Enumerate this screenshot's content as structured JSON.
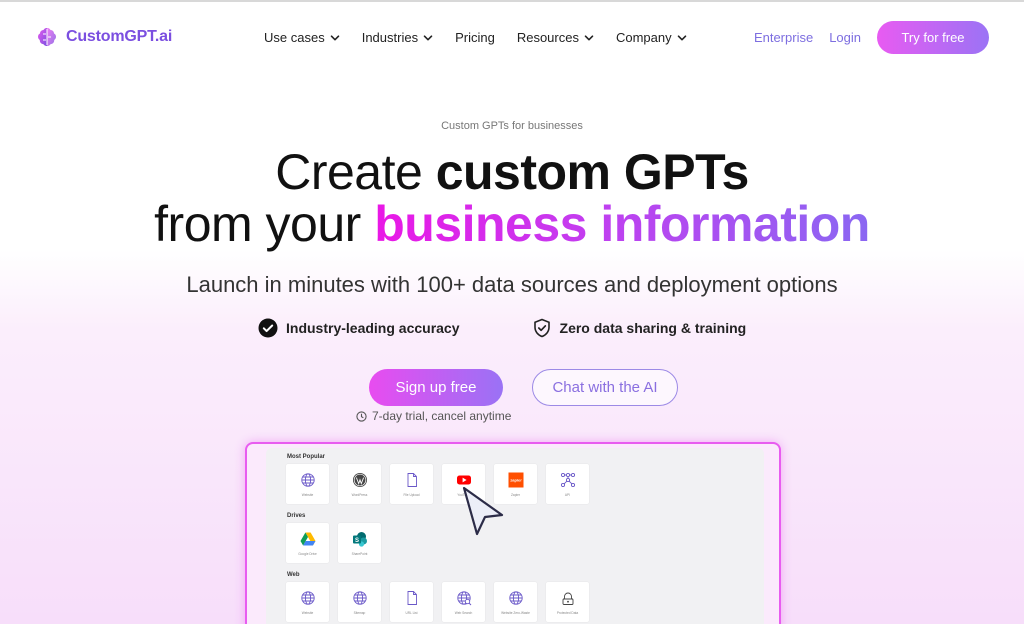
{
  "brand": {
    "name": "CustomGPT.ai"
  },
  "nav": {
    "menu": [
      {
        "label": "Use cases",
        "has_dropdown": true
      },
      {
        "label": "Industries",
        "has_dropdown": true
      },
      {
        "label": "Pricing",
        "has_dropdown": false
      },
      {
        "label": "Resources",
        "has_dropdown": true
      },
      {
        "label": "Company",
        "has_dropdown": true
      }
    ],
    "enterprise": "Enterprise",
    "login": "Login",
    "cta": "Try for free"
  },
  "hero": {
    "eyebrow": "Custom GPTs for businesses",
    "line1_plain": "Create ",
    "line1_bold": "custom GPTs",
    "line2_plain": "from your ",
    "line2_gradient": "business information",
    "subtitle": "Launch in minutes with 100+ data sources and deployment options",
    "features": [
      {
        "icon": "check-circle-icon",
        "label": "Industry-leading accuracy"
      },
      {
        "icon": "shield-check-icon",
        "label": "Zero data sharing & training"
      }
    ],
    "primary_cta": "Sign up free",
    "secondary_cta": "Chat with the AI",
    "trial_note": "7-day trial, cancel anytime"
  },
  "preview": {
    "sections": [
      {
        "title": "Most Popular",
        "items": [
          {
            "label": "Website",
            "icon": "globe-icon"
          },
          {
            "label": "WordPress",
            "icon": "wordpress-icon"
          },
          {
            "label": "File Upload",
            "icon": "file-icon"
          },
          {
            "label": "YouTube",
            "icon": "youtube-icon"
          },
          {
            "label": "Zapier",
            "icon": "zapier-icon"
          },
          {
            "label": "API",
            "icon": "api-icon"
          }
        ]
      },
      {
        "title": "Drives",
        "items": [
          {
            "label": "Google Drive",
            "icon": "google-drive-icon"
          },
          {
            "label": "SharePoint",
            "icon": "sharepoint-icon"
          }
        ]
      },
      {
        "title": "Web",
        "items": [
          {
            "label": "Website",
            "icon": "globe-icon"
          },
          {
            "label": "Sitemap",
            "icon": "globe-icon"
          },
          {
            "label": "URL List",
            "icon": "file-icon"
          },
          {
            "label": "Web Search",
            "icon": "globe-search-icon"
          },
          {
            "label": "Website Zero-Waste",
            "icon": "globe-icon"
          },
          {
            "label": "Protected Data",
            "icon": "lock-icon"
          }
        ]
      }
    ]
  },
  "colors": {
    "accent_pink": "#ea17e6",
    "accent_purple": "#8a67f2",
    "link": "#7d6ee0"
  }
}
